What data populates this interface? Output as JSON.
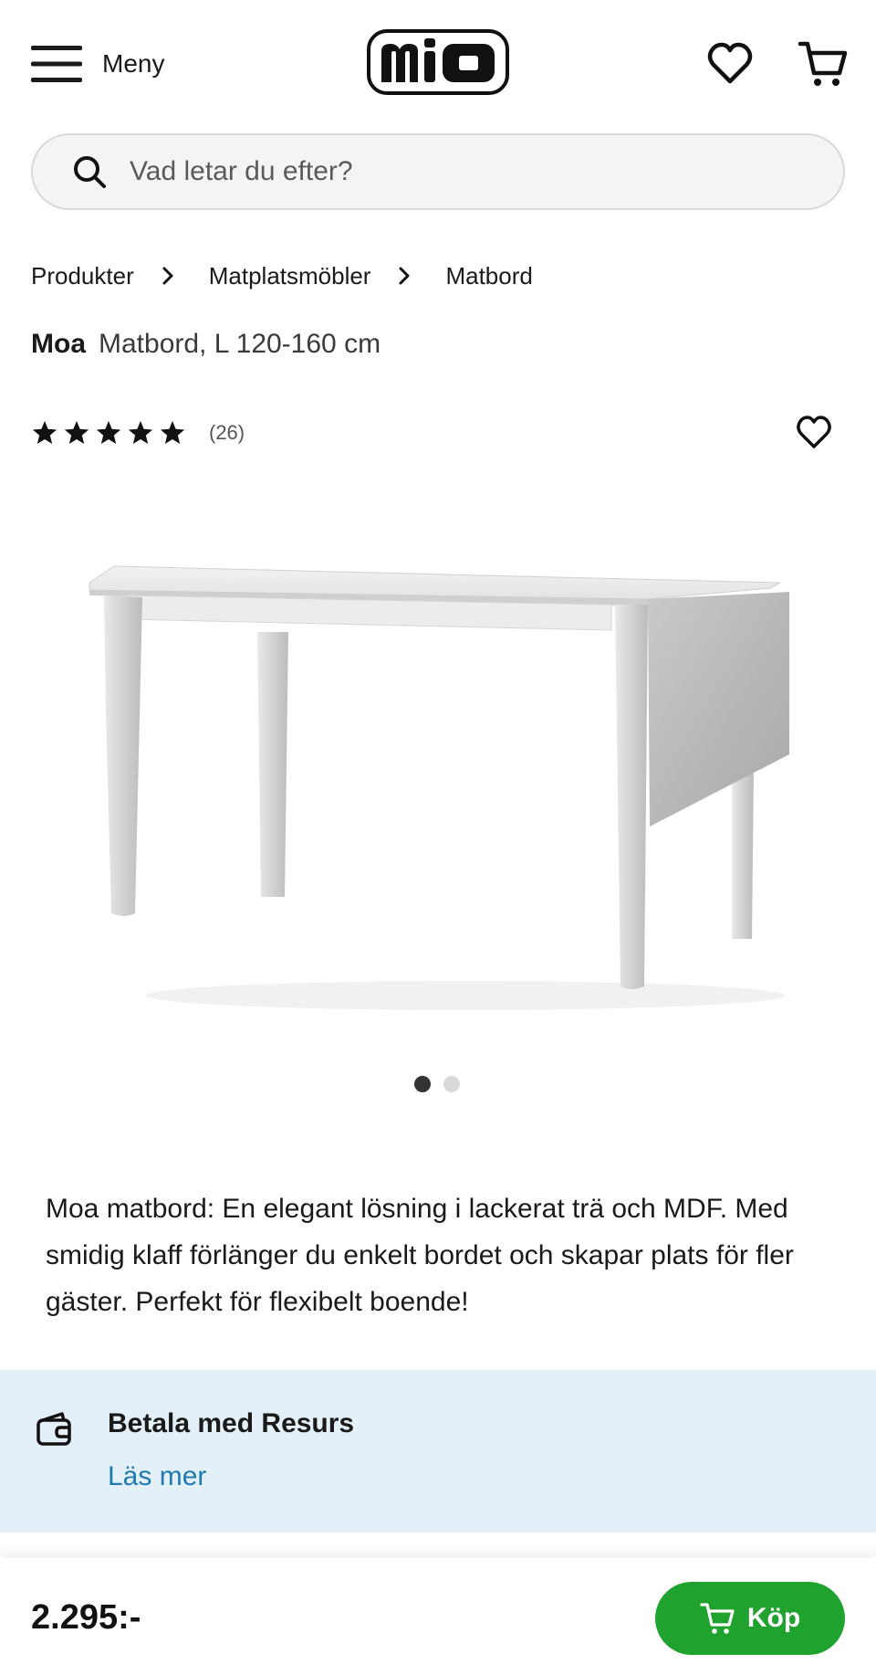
{
  "header": {
    "menu_label": "Meny",
    "logo_text": "mio"
  },
  "search": {
    "placeholder": "Vad letar du efter?"
  },
  "breadcrumb": [
    "Produkter",
    "Matplatsmöbler",
    "Matbord"
  ],
  "product": {
    "brand": "Moa",
    "name": "Matbord, L 120-160 cm",
    "rating": 5,
    "review_count": "(26)",
    "description": "Moa matbord: En elegant lösning i lackerat trä och MDF. Med smidig klaff förlänger du enkelt bordet och skapar plats för fler gäster. Perfekt för flexibelt boende!",
    "price": "2.295:-",
    "image_count": 2,
    "current_image": 1
  },
  "payment": {
    "title": "Betala med Resurs",
    "link": "Läs mer"
  },
  "actions": {
    "buy_label": "Köp"
  },
  "icons": [
    "hamburger-icon",
    "heart-icon",
    "cart-icon",
    "search-icon",
    "chevron-right-icon",
    "star-icon",
    "wallet-icon"
  ],
  "colors": {
    "buy_button": "#1fa22e",
    "payment_banner": "#e4f0f8",
    "link": "#1f7ab0"
  }
}
